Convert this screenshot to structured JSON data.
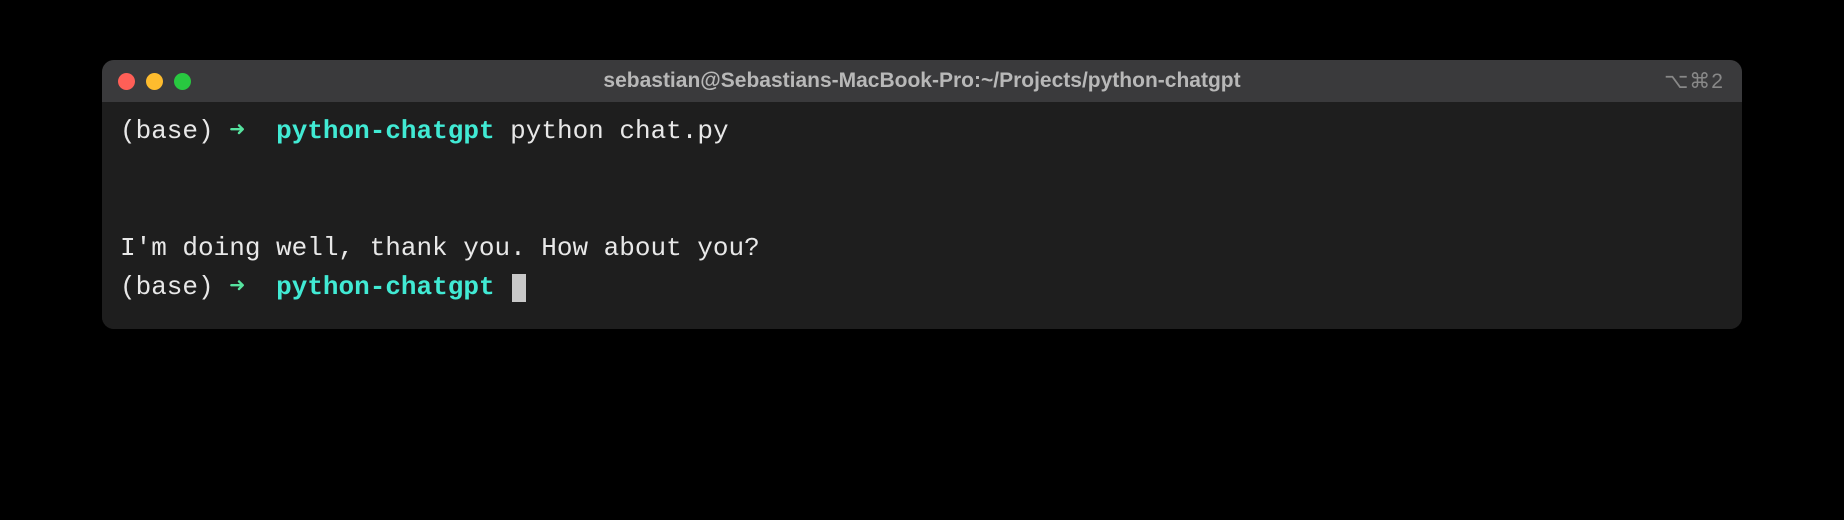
{
  "titlebar": {
    "title": "sebastian@Sebastians-MacBook-Pro:~/Projects/python-chatgpt",
    "pane_indicator": "⌥⌘2"
  },
  "prompt1": {
    "env": "(base)",
    "arrow": "➜",
    "cwd": "python-chatgpt",
    "command": "python chat.py"
  },
  "output": {
    "line1": "I'm doing well, thank you. How about you?"
  },
  "prompt2": {
    "env": "(base)",
    "arrow": "➜",
    "cwd": "python-chatgpt"
  }
}
